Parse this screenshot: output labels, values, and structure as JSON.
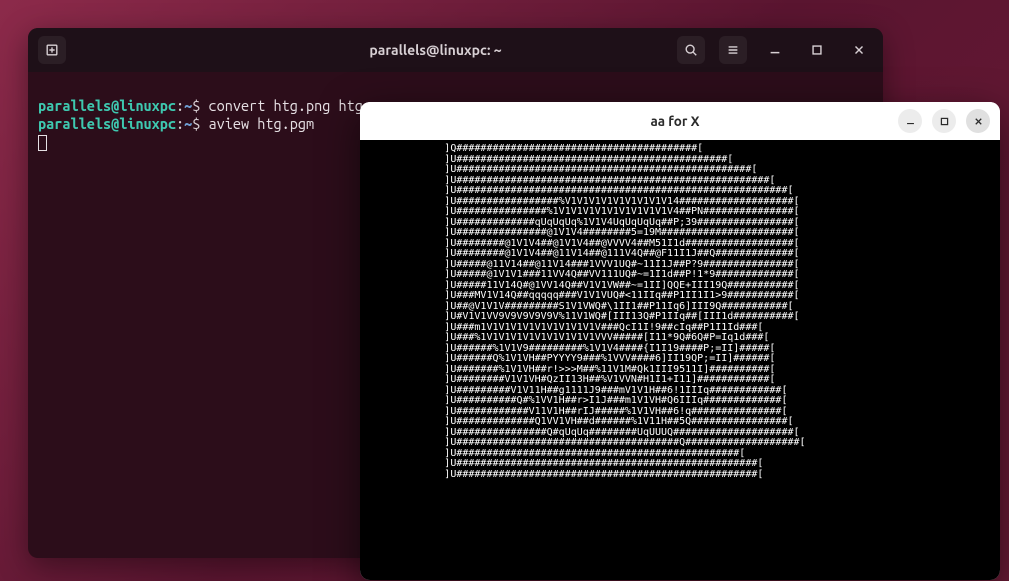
{
  "terminal": {
    "title": "parallels@linuxpc: ~",
    "prompt_user": "parallels@linuxpc",
    "prompt_sep": ":",
    "prompt_path": "~",
    "prompt_end": "$",
    "lines": [
      {
        "cmd": "convert htg.png htg.pgm"
      },
      {
        "cmd": "aview htg.pgm"
      }
    ]
  },
  "aaview": {
    "title": "aa for X",
    "ascii": [
      "]Q########################################[",
      "]U#############################################[",
      "]U#################################################[",
      "]U####################################################[",
      "]U#######################################################[",
      "]U#################%V1V1V1V1V1V1V1V1V14###################[",
      "]U###############%1V1V1V1V1V1V1V1V1V1V4##PN###############[",
      "]U#############qUqUqUq%1V1V4UqUqUqUq##P;39################[",
      "]U###############@1V1V4########5=19M######################[",
      "]U########@1V1V4##@1V1V4##@VVVV4##M51I1d##################[",
      "]U########@1V1V4##@11V14##@111V4Q##@F11I1J##Q#############[",
      "]U#####@11V14##@11V14###1VVV1UQ#~11I1J##P?9###############[",
      "]U#####@1V1V1###11VV4Q##VV111UQ#~=1I1d##P!1*9#############[",
      "]U#####11V14Q#@1VV14Q##V1V1VW##~=1II]QQE+III19Q###########[",
      "]U###MV1V14Q##qqqqq###V1V1VUQ#<11IIq##P1II1I1>9###########[",
      "]U##@V1V1V#########S1V1VWQ#\\1II1##P11Iq6]III9Q###########[",
      "]U#V1V1VV9V9V9V9V9V%11V1WQ#[III13Q#P1IIq##[III1d##########[",
      "]U###m1V1V1V1V1V1V1V1V1V1V###QcI1I!9##cIq##P1I1Id###[",
      "]U###%1V1V1V1V1V1V1V1V1V1VVV#####[I11*9Q#6Q#P=Iq1d###[",
      "]U######%1V1V9#########%1V1V4####{I1I19####P;=II]#####[",
      "]U######Q%1V1VH##PYYYY9###%1VVV####6]II19QP;=II]######[",
      "]U#######%1V1VH##r!>>>M##%11V1M#Qk1III9511I]##########[",
      "]U########V1V1VH#QzII13H##%V1VVN#H1I1+I11]############[",
      "]U#########V1V11H##g1111J9###mV1V1H##6!1IIIq############[",
      "]U##########Q#%1VV1H##r>I1J###m1V1VH#Q6IIIq#############[",
      "]U############V11V1H##rIJ#####%1V1VH##6!q###############[",
      "]U#############Q1VV1VH##d######%1V11H##5Q################[",
      "]U###############Q#qUqUq########UqUUUQ####################[",
      "]U#####################################Q###################[",
      "]U###############################################[",
      "]U##################################################[",
      "]U##################################################["
    ]
  },
  "icons": {
    "new_tab": "new-tab-icon",
    "search": "search-icon",
    "menu": "hamburger-icon",
    "minimize": "minimize-icon",
    "maximize": "maximize-icon",
    "close": "close-icon"
  }
}
